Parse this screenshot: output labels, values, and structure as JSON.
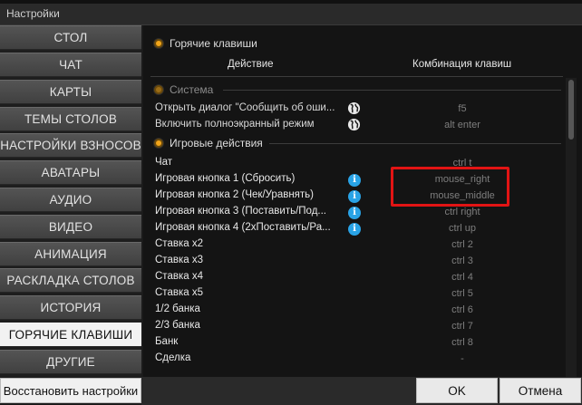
{
  "window": {
    "title": "Настройки"
  },
  "sidebar": {
    "items": [
      {
        "label": "СТОЛ"
      },
      {
        "label": "ЧАТ"
      },
      {
        "label": "КАРТЫ"
      },
      {
        "label": "ТЕМЫ СТОЛОВ"
      },
      {
        "label": "НАСТРОЙКИ ВЗНОСОВ"
      },
      {
        "label": "АВАТАРЫ"
      },
      {
        "label": "АУДИО"
      },
      {
        "label": "ВИДЕО"
      },
      {
        "label": "АНИМАЦИЯ"
      },
      {
        "label": "РАСКЛАДКА СТОЛОВ"
      },
      {
        "label": "ИСТОРИЯ"
      },
      {
        "label": "ГОРЯЧИЕ КЛАВИШИ",
        "active": true
      },
      {
        "label": "ДРУГИЕ"
      }
    ],
    "restore_label": "Восстановить настройки"
  },
  "panel": {
    "title": "Горячие клавиши",
    "col_action": "Действие",
    "col_combo": "Комбинация клавиш",
    "system": {
      "title": "Система",
      "rows": [
        {
          "label": "Открыть диалог \"Сообщить об оши...",
          "value": "f5",
          "icon": "globe-icon"
        },
        {
          "label": "Включить полноэкранный режим",
          "value": "alt enter",
          "icon": "globe-icon"
        }
      ]
    },
    "game": {
      "title": "Игровые действия",
      "rows": [
        {
          "label": "Чат",
          "value": "ctrl t",
          "icon": ""
        },
        {
          "label": "Игровая кнопка 1 (Сбросить)",
          "value": "mouse_right",
          "icon": "info-icon"
        },
        {
          "label": "Игровая кнопка 2 (Чек/Уравнять)",
          "value": "mouse_middle",
          "icon": "info-icon"
        },
        {
          "label": "Игровая кнопка 3 (Поставить/Под...",
          "value": "ctrl right",
          "icon": "info-icon"
        },
        {
          "label": "Игровая кнопка 4 (2хПоставить/Ра...",
          "value": "ctrl up",
          "icon": "info-icon"
        },
        {
          "label": "Ставка x2",
          "value": "ctrl 2",
          "icon": ""
        },
        {
          "label": "Ставка x3",
          "value": "ctrl 3",
          "icon": ""
        },
        {
          "label": "Ставка x4",
          "value": "ctrl 4",
          "icon": ""
        },
        {
          "label": "Ставка x5",
          "value": "ctrl 5",
          "icon": ""
        },
        {
          "label": "1/2 банка",
          "value": "ctrl 6",
          "icon": ""
        },
        {
          "label": "2/3 банка",
          "value": "ctrl 7",
          "icon": ""
        },
        {
          "label": "Банк",
          "value": "ctrl 8",
          "icon": ""
        },
        {
          "label": "Сделка",
          "value": "-",
          "icon": ""
        }
      ]
    }
  },
  "buttons": {
    "ok": "OK",
    "cancel": "Отмена"
  },
  "colors": {
    "accent": "#f2a51a",
    "info": "#29a3e6",
    "highlight": "#e21414",
    "active_tab": "#f2f2f2"
  }
}
